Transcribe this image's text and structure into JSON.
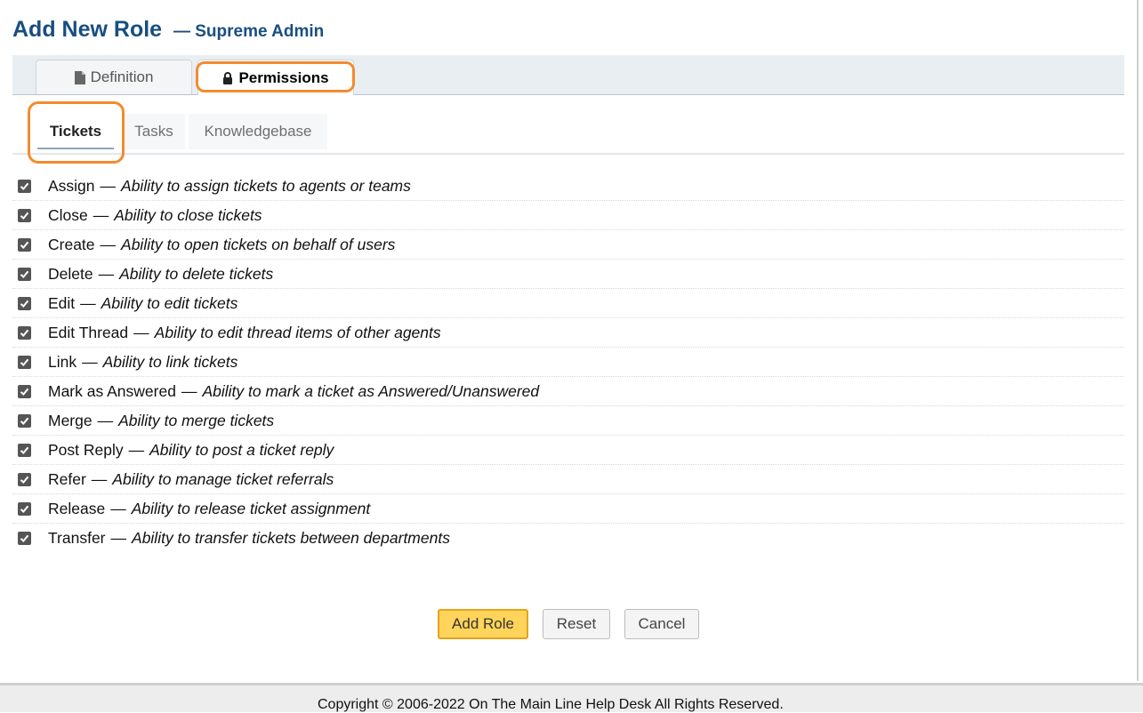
{
  "header": {
    "title": "Add New Role",
    "subtitle": "— Supreme Admin"
  },
  "main_tabs": [
    {
      "label": "Definition",
      "icon": "document-icon",
      "active": false
    },
    {
      "label": "Permissions",
      "icon": "lock-icon",
      "active": true
    }
  ],
  "sub_tabs": [
    {
      "label": "Tickets",
      "active": true
    },
    {
      "label": "Tasks",
      "active": false
    },
    {
      "label": "Knowledgebase",
      "active": false
    }
  ],
  "separator": "—",
  "permissions": [
    {
      "name": "Assign",
      "description": "Ability to assign tickets to agents or teams",
      "checked": true
    },
    {
      "name": "Close",
      "description": "Ability to close tickets",
      "checked": true
    },
    {
      "name": "Create",
      "description": "Ability to open tickets on behalf of users",
      "checked": true
    },
    {
      "name": "Delete",
      "description": "Ability to delete tickets",
      "checked": true
    },
    {
      "name": "Edit",
      "description": "Ability to edit tickets",
      "checked": true
    },
    {
      "name": "Edit Thread",
      "description": "Ability to edit thread items of other agents",
      "checked": true
    },
    {
      "name": "Link",
      "description": "Ability to link tickets",
      "checked": true
    },
    {
      "name": "Mark as Answered",
      "description": "Ability to mark a ticket as Answered/Unanswered",
      "checked": true
    },
    {
      "name": "Merge",
      "description": "Ability to merge tickets",
      "checked": true
    },
    {
      "name": "Post Reply",
      "description": "Ability to post a ticket reply",
      "checked": true
    },
    {
      "name": "Refer",
      "description": "Ability to manage ticket referrals",
      "checked": true
    },
    {
      "name": "Release",
      "description": "Ability to release ticket assignment",
      "checked": true
    },
    {
      "name": "Transfer",
      "description": "Ability to transfer tickets between departments",
      "checked": true
    }
  ],
  "buttons": {
    "add": "Add Role",
    "reset": "Reset",
    "cancel": "Cancel"
  },
  "footer": {
    "copyright": "Copyright © 2006-2022 On The Main Line Help Desk All Rights Reserved."
  },
  "colors": {
    "title": "#184E81",
    "highlight": "#F38B2E",
    "primary_button": "#FFD45A"
  }
}
